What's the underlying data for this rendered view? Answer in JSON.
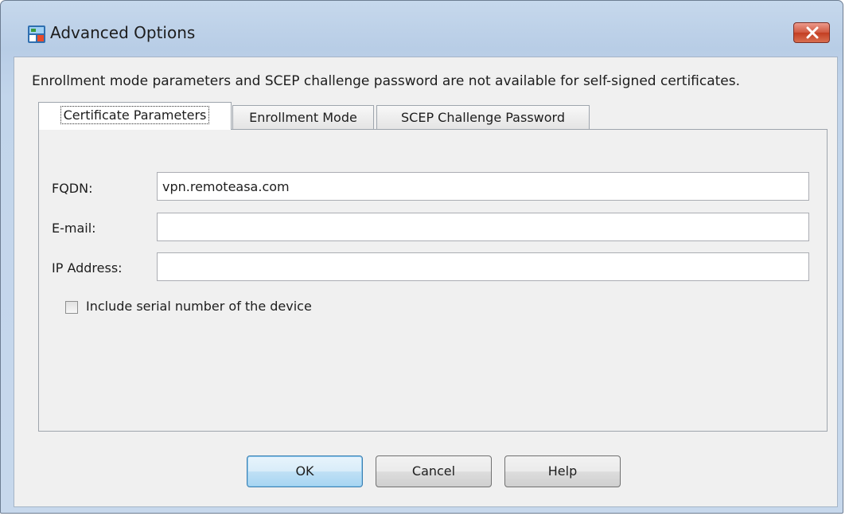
{
  "window": {
    "title": "Advanced Options",
    "app_icon": "asdm-app-icon",
    "close_icon": "close-x-icon"
  },
  "info_text": "Enrollment mode parameters and SCEP challenge password are not available for self-signed certificates.",
  "tabs": [
    {
      "label": "Certificate Parameters",
      "selected": true
    },
    {
      "label": "Enrollment Mode",
      "selected": false
    },
    {
      "label": "SCEP Challenge Password",
      "selected": false
    }
  ],
  "fields": {
    "fqdn": {
      "label": "FQDN:",
      "value": "vpn.remoteasa.com"
    },
    "email": {
      "label": "E-mail:",
      "value": ""
    },
    "ip": {
      "label": "IP Address:",
      "value": ""
    }
  },
  "serial_checkbox": {
    "label": "Include serial number of the device",
    "checked": false
  },
  "buttons": {
    "ok": "OK",
    "cancel": "Cancel",
    "help": "Help"
  }
}
